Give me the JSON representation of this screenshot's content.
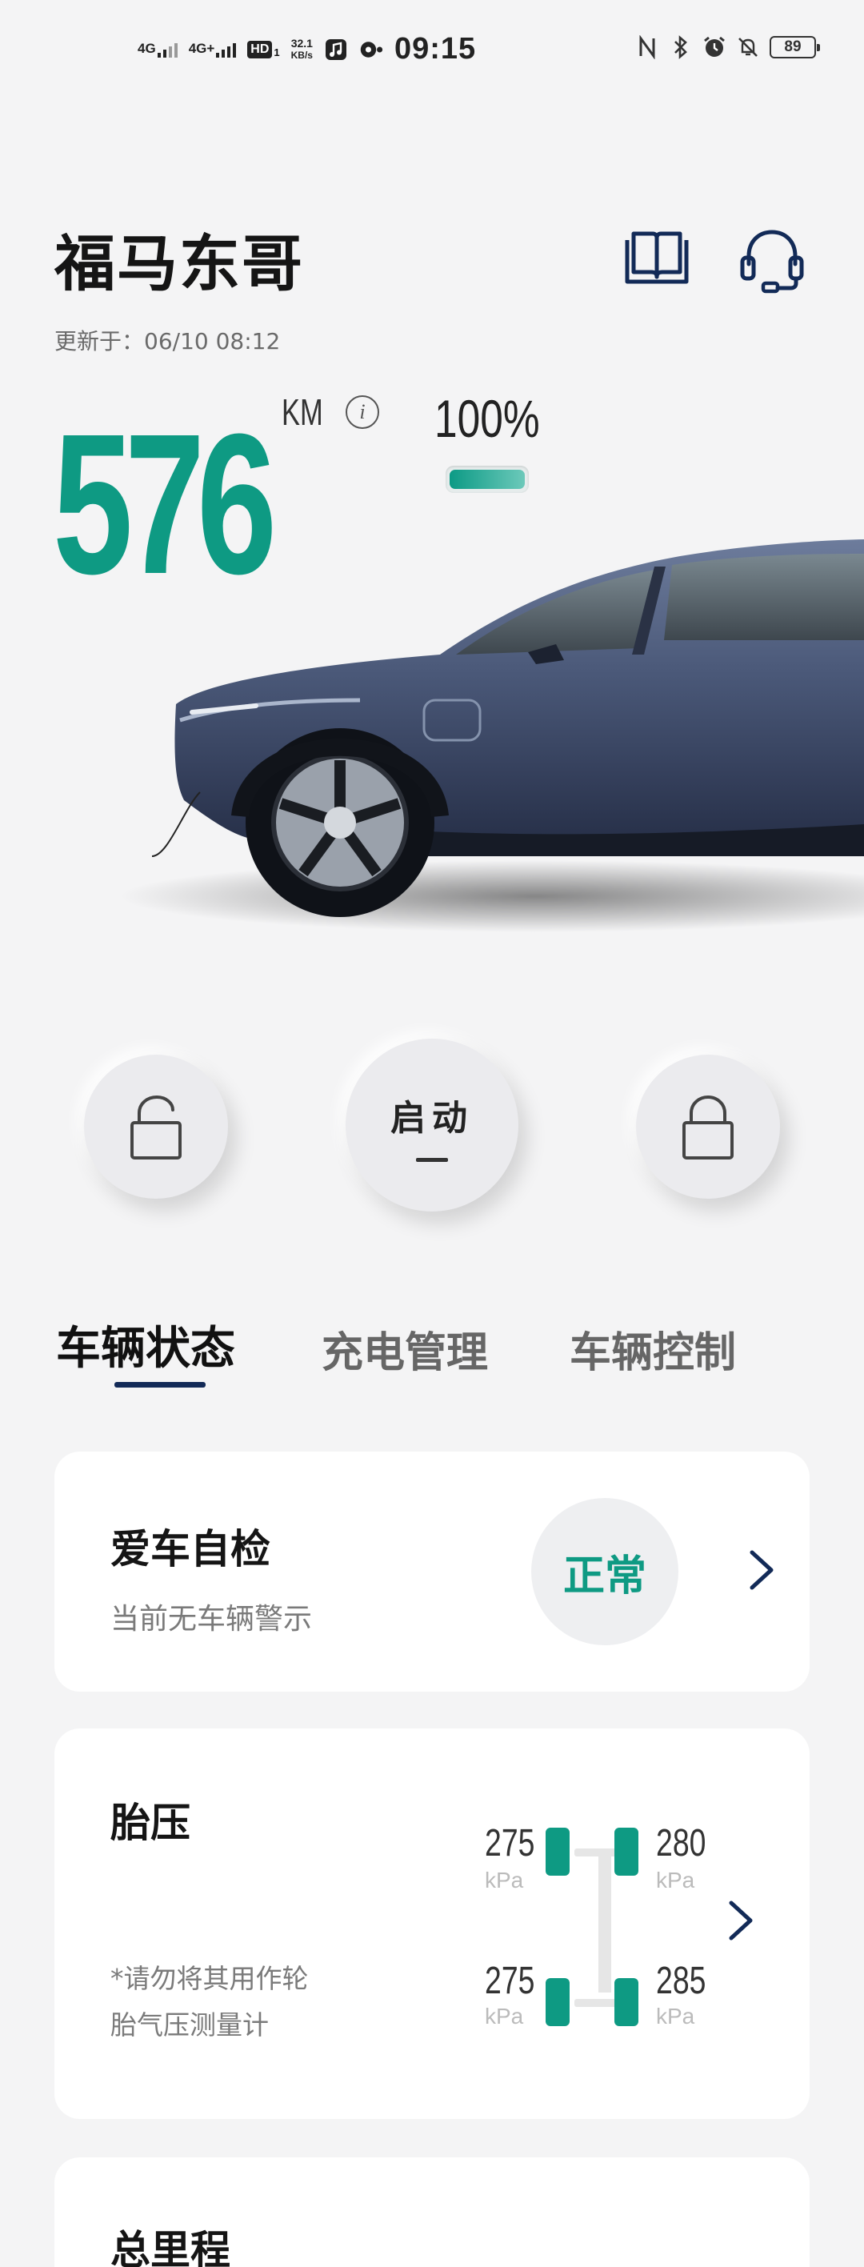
{
  "status_bar": {
    "net1": "4G",
    "net2": "4G+",
    "hd": "HD",
    "hd_sub": "1",
    "speed_value": "32.1",
    "speed_unit": "KB/s",
    "time": "09:15",
    "battery": "89"
  },
  "header": {
    "title": "福马东哥",
    "updated": "更新于：06/10 08:12"
  },
  "range": {
    "value": "576",
    "unit": "KM",
    "info_glyph": "i",
    "battery_percent_label": "100%",
    "battery_level": 1.0
  },
  "controls": {
    "start_label": "启动"
  },
  "tabs": [
    {
      "label": "车辆状态",
      "active": true
    },
    {
      "label": "充电管理",
      "active": false
    },
    {
      "label": "车辆控制",
      "active": false
    }
  ],
  "self_check": {
    "title": "爱车自检",
    "subtitle": "当前无车辆警示",
    "status": "正常"
  },
  "tire_pressure": {
    "title": "胎压",
    "note_line1": "*请勿将其用作轮",
    "note_line2": "胎气压测量计",
    "front_left": "275",
    "front_right": "280",
    "rear_left": "275",
    "rear_right": "285",
    "unit": "kPa"
  },
  "mileage": {
    "title": "总里程"
  },
  "colors": {
    "accent": "#0e9a83",
    "navy": "#122a57",
    "background": "#f4f4f5"
  }
}
